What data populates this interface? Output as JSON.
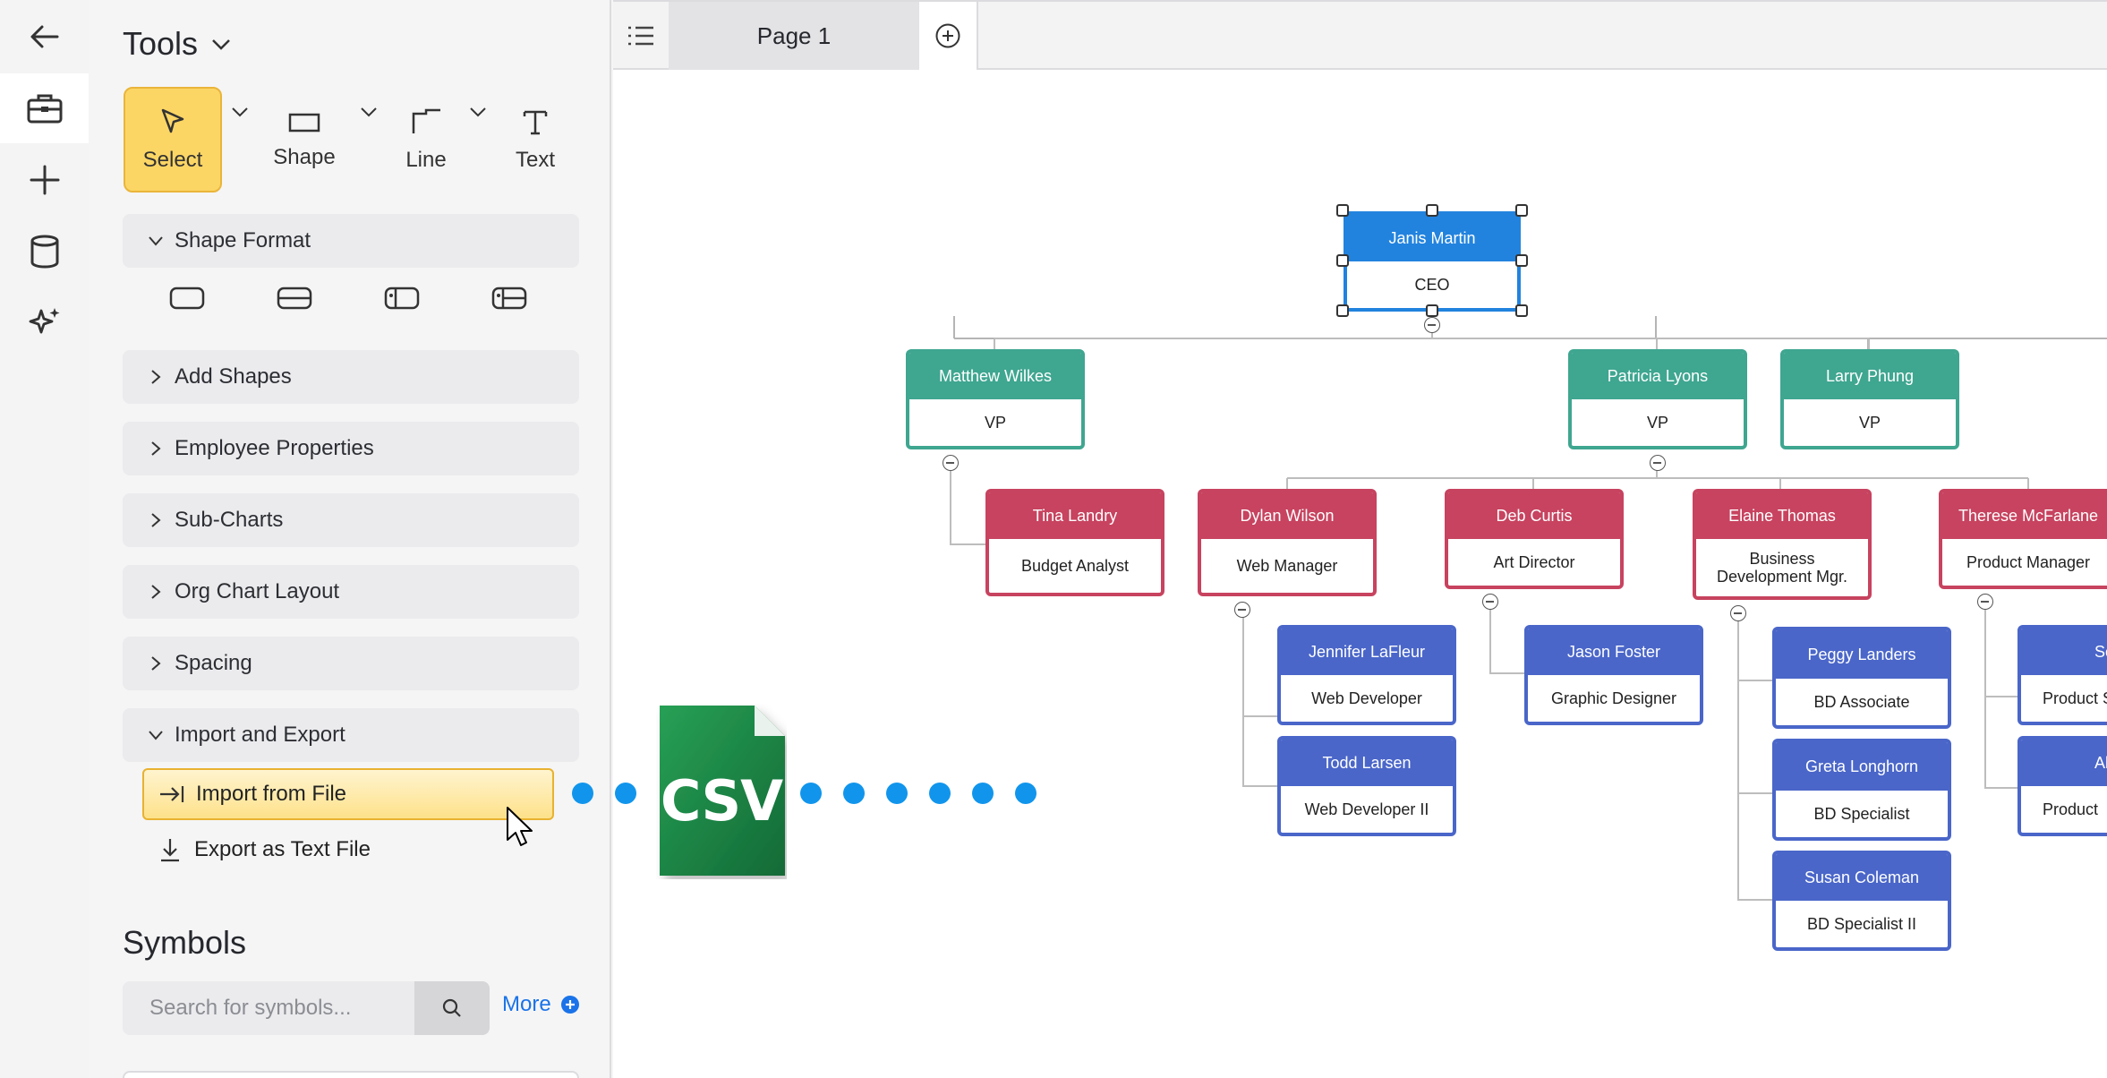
{
  "rail": {
    "icons": [
      "back-arrow-icon",
      "toolbox-icon",
      "plus-icon",
      "database-icon",
      "sparkle-icon"
    ]
  },
  "tools": {
    "title": "Tools",
    "items": [
      {
        "label": "Select",
        "icon": "pointer-icon",
        "selected": true
      },
      {
        "label": "Shape",
        "icon": "rectangle-icon"
      },
      {
        "label": "Line",
        "icon": "line-icon"
      },
      {
        "label": "Text",
        "icon": "text-icon"
      }
    ]
  },
  "sections": {
    "shape_format": "Shape Format",
    "add_shapes": "Add Shapes",
    "employee_properties": "Employee Properties",
    "sub_charts": "Sub-Charts",
    "org_chart_layout": "Org Chart Layout",
    "spacing": "Spacing",
    "import_export": "Import and Export"
  },
  "import_export": {
    "import_label": "Import from File",
    "export_label": "Export as Text File"
  },
  "symbols": {
    "title": "Symbols",
    "search_placeholder": "Search for symbols...",
    "more_label": "More"
  },
  "topbar": {
    "page_tab": "Page 1"
  },
  "csv_badge": "CSV",
  "colors": {
    "select_highlight": "#fcd665",
    "ceo_blue": "#2283de",
    "vp_teal": "#3fa690",
    "manager_red": "#c7435f",
    "staff_blue": "#4a66c9",
    "flow_dot": "#1195ec",
    "csv_green": "#1e8a45"
  },
  "org_chart": {
    "ceo": {
      "name": "Janis Martin",
      "title": "CEO"
    },
    "vps": [
      {
        "name": "Matthew Wilkes",
        "title": "VP"
      },
      {
        "name": "Patricia Lyons",
        "title": "VP"
      },
      {
        "name": "Larry Phung",
        "title": "VP"
      }
    ],
    "managers": [
      {
        "name": "Tina Landry",
        "title": "Budget Analyst"
      },
      {
        "name": "Dylan Wilson",
        "title": "Web Manager"
      },
      {
        "name": "Deb Curtis",
        "title": "Art Director"
      },
      {
        "name": "Elaine Thomas",
        "title": "Business Development Mgr."
      },
      {
        "name": "Therese McFarlane",
        "title": "Product Manager"
      }
    ],
    "staff": [
      {
        "name": "Jennifer LaFleur",
        "title": "Web Developer"
      },
      {
        "name": "Todd Larsen",
        "title": "Web Developer II"
      },
      {
        "name": "Jason Foster",
        "title": "Graphic Designer"
      },
      {
        "name": "Peggy Landers",
        "title": "BD Associate"
      },
      {
        "name": "Greta Longhorn",
        "title": "BD Specialist"
      },
      {
        "name": "Susan Coleman",
        "title": "BD Specialist II"
      },
      {
        "name": "Scott",
        "title": "Product S"
      },
      {
        "name": "Alan",
        "title": "Product"
      }
    ]
  }
}
